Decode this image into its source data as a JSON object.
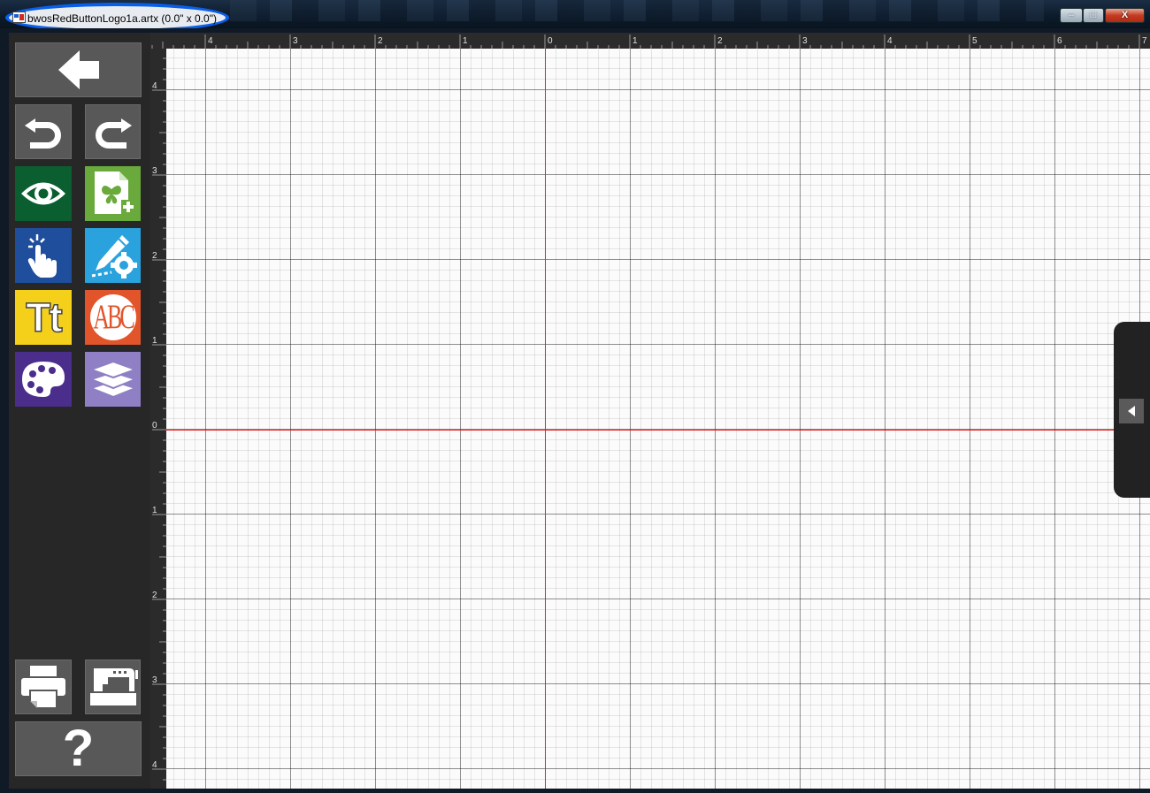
{
  "window": {
    "title": "bwosRedButtonLogo1a.artx (0.0\" x 0.0\")",
    "controls": {
      "minimize": "–",
      "maximize": "□",
      "close": "X"
    }
  },
  "toolbar": {
    "buttons": [
      {
        "name": "back",
        "icon": "arrow-left-icon"
      },
      {
        "name": "undo",
        "icon": "undo-icon"
      },
      {
        "name": "redo",
        "icon": "redo-icon"
      },
      {
        "name": "view",
        "icon": "eye-icon",
        "color": "#0a5e2f"
      },
      {
        "name": "new-design",
        "icon": "butterfly-page-add-icon",
        "color": "#6aaa3c"
      },
      {
        "name": "select",
        "icon": "hand-pointer-icon",
        "color": "#1f4e9c"
      },
      {
        "name": "edit-tools",
        "icon": "pencil-gear-icon",
        "color": "#2aa2dd"
      },
      {
        "name": "text",
        "icon": "text-tt-icon",
        "label": "Tt",
        "color": "#f4d01b"
      },
      {
        "name": "monogram",
        "icon": "monogram-abc-icon",
        "label": "ABC",
        "color": "#e2542a"
      },
      {
        "name": "colors",
        "icon": "palette-icon",
        "color": "#4b2d8c"
      },
      {
        "name": "layers",
        "icon": "layers-icon",
        "color": "#8f7fc4"
      },
      {
        "name": "print",
        "icon": "printer-icon"
      },
      {
        "name": "embroider",
        "icon": "sewing-machine-icon"
      },
      {
        "name": "help",
        "icon": "question-icon",
        "label": "?"
      }
    ]
  },
  "ruler": {
    "top_labels": [
      "4",
      "3",
      "2",
      "1",
      "0",
      "1",
      "2",
      "3",
      "4",
      "5",
      "6",
      "7"
    ],
    "left_labels": [
      "4",
      "3",
      "2",
      "1",
      "0",
      "1",
      "2",
      "3",
      "4"
    ]
  },
  "canvas": {
    "axis_color": "#e02020",
    "grid": true
  },
  "side_panel": {
    "toggle_icon": "triangle-left-icon"
  }
}
